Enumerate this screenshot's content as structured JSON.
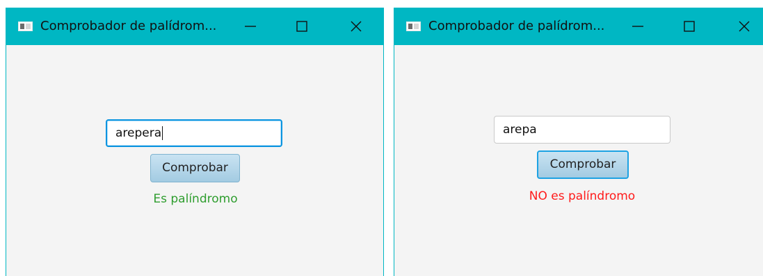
{
  "colors": {
    "titlebar": "#00b7c3",
    "window_bg": "#f4f4f4",
    "focus_ring": "#0a94e0",
    "palindrome": "#2e9d2e",
    "not_palindrome": "#ff1a1a"
  },
  "windows": [
    {
      "title": "Comprobador de palídrom...",
      "icons": {
        "app": "app-window-icon",
        "minimize": "minimize-icon",
        "maximize": "maximize-icon",
        "close": "close-icon"
      },
      "input": {
        "value": "arepera",
        "focused": true
      },
      "button_label": "Comprobar",
      "result": {
        "text": "Es palíndromo",
        "color": "#2e9d2e"
      }
    },
    {
      "title": "Comprobador de palídrom...",
      "icons": {
        "app": "app-window-icon",
        "minimize": "minimize-icon",
        "maximize": "maximize-icon",
        "close": "close-icon"
      },
      "input": {
        "value": "arepa",
        "focused": false
      },
      "button_label": "Comprobar",
      "result": {
        "text": "NO es palíndromo",
        "color": "#ff1a1a"
      }
    }
  ]
}
